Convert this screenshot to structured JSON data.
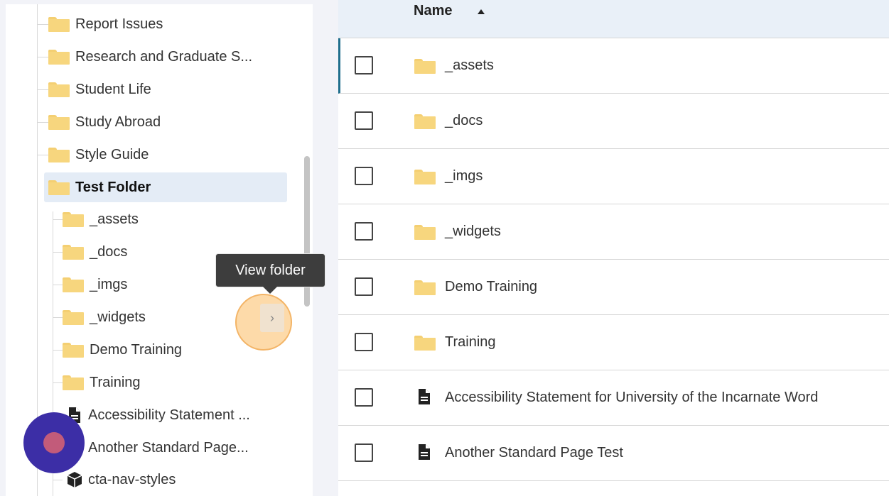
{
  "tree": {
    "items": [
      {
        "label": "Report Issues",
        "type": "folder"
      },
      {
        "label": "Research and Graduate S...",
        "type": "folder"
      },
      {
        "label": "Student Life",
        "type": "folder"
      },
      {
        "label": "Study Abroad",
        "type": "folder"
      },
      {
        "label": "Style Guide",
        "type": "folder"
      },
      {
        "label": "Test Folder",
        "type": "folder",
        "selected": true
      },
      {
        "label": "_assets",
        "type": "folder"
      },
      {
        "label": "_docs",
        "type": "folder"
      },
      {
        "label": "_imgs",
        "type": "folder"
      },
      {
        "label": "_widgets",
        "type": "folder"
      },
      {
        "label": "Demo Training",
        "type": "folder"
      },
      {
        "label": "Training",
        "type": "folder"
      },
      {
        "label": "Accessibility Statement ...",
        "type": "page"
      },
      {
        "label": "Another Standard Page...",
        "type": "page"
      },
      {
        "label": "cta-nav-styles",
        "type": "block"
      }
    ]
  },
  "tooltip": {
    "text": "View folder"
  },
  "view_folder_button": {
    "glyph": "›"
  },
  "list": {
    "header": {
      "name_label": "Name",
      "sort": "ascending"
    },
    "rows": [
      {
        "label": "_assets",
        "type": "folder",
        "active": true
      },
      {
        "label": "_docs",
        "type": "folder"
      },
      {
        "label": "_imgs",
        "type": "folder"
      },
      {
        "label": "_widgets",
        "type": "folder"
      },
      {
        "label": "Demo Training",
        "type": "folder"
      },
      {
        "label": "Training",
        "type": "folder"
      },
      {
        "label": "Accessibility Statement for University of the Incarnate Word",
        "type": "page"
      },
      {
        "label": "Another Standard Page Test",
        "type": "page"
      }
    ]
  },
  "colors": {
    "folder": "#f7d67e",
    "selected_row": "#e4ecf6",
    "active_accent": "#1f6e8c",
    "header_bg": "#e9f0f8",
    "tooltip_bg": "#3d3d3d"
  }
}
